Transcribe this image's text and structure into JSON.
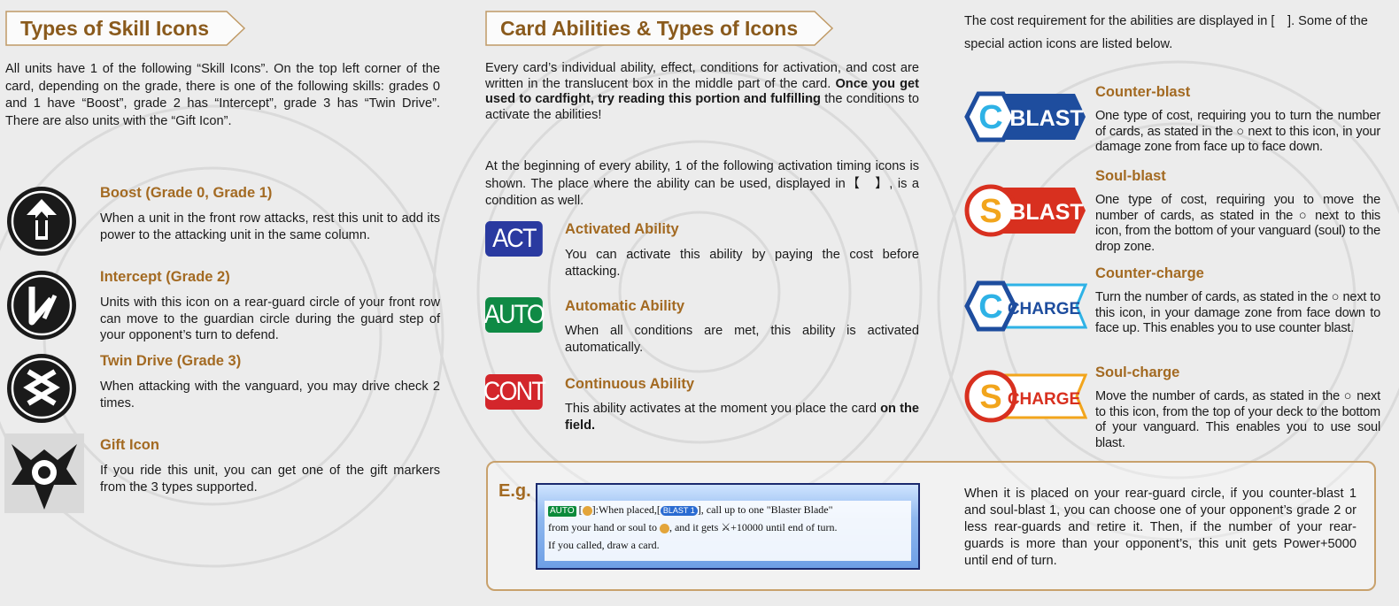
{
  "left": {
    "title": "Types of Skill Icons",
    "intro": "All units have 1 of the following “Skill Icons”. On the top left corner of the card, depending on the grade, there is one of the following skills: grades 0 and 1 have “Boost”, grade 2 has “Intercept”, grade 3 has “Twin Drive”. There are also units with the “Gift Icon”.",
    "items": [
      {
        "icon": "boost-icon",
        "title": "Boost (Grade 0, Grade 1)",
        "body": "When a unit in the front row attacks, rest this unit to add its power to the attacking unit in the same column."
      },
      {
        "icon": "intercept-icon",
        "title": "Intercept (Grade 2)",
        "body": "Units with this icon on a rear-guard circle of your front row can move to the guardian circle during the guard step of your opponent’s turn to defend."
      },
      {
        "icon": "twin-drive-icon",
        "title": "Twin Drive (Grade 3)",
        "body": "When attacking with the vanguard, you may drive check 2 times."
      },
      {
        "icon": "gift-icon",
        "title": "Gift Icon",
        "body": "If you ride this unit, you can get one of the gift markers from the 3 types supported."
      }
    ]
  },
  "middle": {
    "title": "Card Abilities & Types of Icons",
    "intro_plain": "Every card’s individual ability, effect, conditions for activation, and cost are written in the translucent box in the middle part of the card.",
    "intro_bold": "Once you get used to cardfight, try reading this portion and fulfilling",
    "intro_tail": "the conditions to activate the abilities!",
    "timing_para": "At the beginning of every ability, 1 of the following activation timing icons is shown. The place where the ability can be used, displayed in【　】, is a condition as well.",
    "abilities": [
      {
        "icon_text": "ACT",
        "color": "#2a3aa0",
        "title": "Activated Ability",
        "body": "You can activate this ability by paying the cost before attacking.",
        "body_bold": ""
      },
      {
        "icon_text": "AUTO",
        "color": "#0f8a45",
        "title": "Automatic Ability",
        "body": "When all conditions are met, this ability is activated automatically.",
        "body_bold": ""
      },
      {
        "icon_text": "CONT",
        "color": "#d3262b",
        "title": "Continuous Ability",
        "body": "This ability activates at the moment you place the card",
        "body_bold": "on the field."
      }
    ]
  },
  "right": {
    "intro": "The cost requirement for the abilities are displayed in [　]. Some of the special action icons are listed below.",
    "costs": [
      {
        "letter": "C",
        "word": "BLAST",
        "color": "#1e4d9e",
        "title": "Counter-blast",
        "body": "One type of cost, requiring you to turn the number of cards, as stated in the ○ next to this icon, in your damage zone from face up to face down."
      },
      {
        "letter": "S",
        "word": "BLAST",
        "color": "#d8301f",
        "title": "Soul-blast",
        "body": "One type of cost, requiring you to move the number of cards, as stated in the ○ next to this icon, from the bottom of your vanguard (soul) to the drop zone."
      },
      {
        "letter": "C",
        "word": "CHARGE",
        "color": "#1e4d9e",
        "title": "Counter-charge",
        "body": "Turn the number of cards, as stated in the ○ next to this icon, in your damage zone from face down to face up. This enables you to use counter blast."
      },
      {
        "letter": "S",
        "word": "CHARGE",
        "color": "#d8301f",
        "title": "Soul-charge",
        "body": "Move the number of cards, as stated in the ○ next to this icon, from the top of your deck to the bottom of your vanguard. This enables you to use soul blast."
      }
    ]
  },
  "example": {
    "label": "E.g.",
    "card_line1_a": "AUTO",
    "card_line1_b": ":When placed,",
    "card_line1_c": "BLAST 1",
    "card_line1_d": "], call up to one \"Blaster Blade\"",
    "card_line2": "from your hand or soul to",
    "card_line2_b": ", and it gets",
    "card_line2_c": "+10000 until end of turn.",
    "card_line3": "If you called, draw a card.",
    "explanation": "When it is placed on your rear-guard circle, if you counter-blast 1 and soul-blast 1, you can choose one of your opponent’s grade 2 or less rear-guards and retire it. Then, if the number of your rear-guards is more than your opponent’s, this unit gets Power+5000 until end of turn."
  }
}
